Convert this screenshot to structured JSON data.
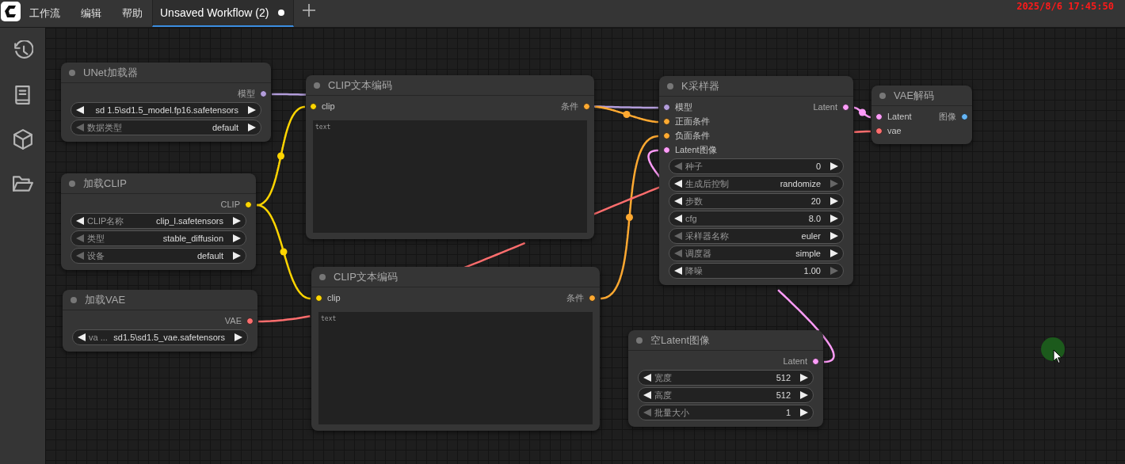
{
  "menu_bar": {
    "items": [
      "工作流",
      "编辑",
      "帮助"
    ]
  },
  "tabs": [
    {
      "label": "Unsaved Workflow (2)",
      "selected": true,
      "unsaved": true
    }
  ],
  "clock": "2025/8/6 17:45:50",
  "sidebar": {
    "items": [
      {
        "kind": "history"
      },
      {
        "kind": "book"
      },
      {
        "kind": "cube"
      },
      {
        "kind": "folder"
      }
    ]
  },
  "nodes": [
    {
      "title": "UNet加载器",
      "outputs": [
        {
          "label": "模型",
          "color": "#b39ddb"
        }
      ],
      "widgets": [
        {
          "value": "sd 1.5\\sd1.5_model.fp16.safetensors",
          "left_enabled": true,
          "right_enabled": true
        },
        {
          "label": "数据类型",
          "value": "default",
          "left_enabled": false,
          "right_enabled": true
        }
      ]
    },
    {
      "title": "CLIP文本编码",
      "inputs": [
        {
          "label": "clip",
          "color": "#ffd500"
        }
      ],
      "outputs": [
        {
          "label": "条件",
          "color": "#ffa931"
        }
      ],
      "textarea": {
        "placeholder": "text"
      }
    },
    {
      "title": "K采样器",
      "inputs": [
        {
          "label": "模型",
          "color": "#b39ddb"
        },
        {
          "label": "正面条件",
          "color": "#ffa931"
        },
        {
          "label": "负面条件",
          "color": "#ffa931"
        },
        {
          "label": "Latent图像",
          "color": "#ff9cf9"
        }
      ],
      "outputs": [
        {
          "label": "Latent",
          "color": "#ff9cf9"
        }
      ],
      "widgets": [
        {
          "label": "种子",
          "value": "0",
          "left_enabled": false,
          "right_enabled": true
        },
        {
          "label": "生成后控制",
          "value": "randomize",
          "left_enabled": true,
          "right_enabled": false
        },
        {
          "label": "步数",
          "value": "20",
          "left_enabled": true,
          "right_enabled": true
        },
        {
          "label": "cfg",
          "value": "8.0",
          "left_enabled": true,
          "right_enabled": true
        },
        {
          "label": "采样器名称",
          "value": "euler",
          "left_enabled": false,
          "right_enabled": true
        },
        {
          "label": "调度器",
          "value": "simple",
          "left_enabled": false,
          "right_enabled": true
        },
        {
          "label": "降噪",
          "value": "1.00",
          "left_enabled": true,
          "right_enabled": false
        }
      ]
    },
    {
      "title": "VAE解码",
      "inputs": [
        {
          "label": "Latent",
          "color": "#ff9cf9"
        },
        {
          "label": "vae",
          "color": "#ff6e6e"
        }
      ],
      "outputs": [
        {
          "label": "图像",
          "color": "#64b5f6"
        }
      ]
    },
    {
      "title": "加载CLIP",
      "outputs": [
        {
          "label": "CLIP",
          "color": "#ffd500"
        }
      ],
      "widgets": [
        {
          "label": "CLIP名称",
          "value": "clip_l.safetensors",
          "left_enabled": true,
          "right_enabled": true
        },
        {
          "label": "类型",
          "value": "stable_diffusion",
          "left_enabled": false,
          "right_enabled": true
        },
        {
          "label": "设备",
          "value": "default",
          "left_enabled": false,
          "right_enabled": true
        }
      ]
    },
    {
      "title": "CLIP文本编码",
      "inputs": [
        {
          "label": "clip",
          "color": "#ffd500"
        }
      ],
      "outputs": [
        {
          "label": "条件",
          "color": "#ffa931"
        }
      ],
      "textarea": {
        "placeholder": "text"
      }
    },
    {
      "title": "加载VAE",
      "outputs": [
        {
          "label": "VAE",
          "color": "#ff6e6e"
        }
      ],
      "widgets": [
        {
          "label": "va ...",
          "value": "sd1.5\\sd1.5_vae.safetensors",
          "left_enabled": true,
          "right_enabled": true
        }
      ]
    },
    {
      "title": "空Latent图像",
      "outputs": [
        {
          "label": "Latent",
          "color": "#ff9cf9"
        }
      ],
      "widgets": [
        {
          "label": "宽度",
          "value": "512",
          "left_enabled": true,
          "right_enabled": true
        },
        {
          "label": "高度",
          "value": "512",
          "left_enabled": true,
          "right_enabled": true
        },
        {
          "label": "批量大小",
          "value": "1",
          "left_enabled": false,
          "right_enabled": true
        }
      ]
    }
  ]
}
